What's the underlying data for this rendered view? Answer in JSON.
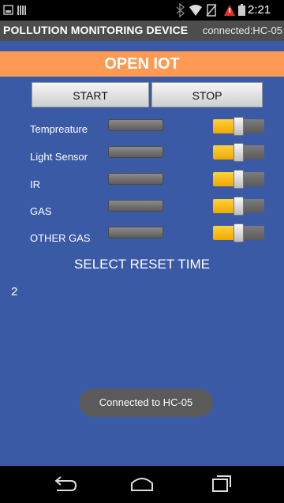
{
  "statusbar": {
    "time": "2:21"
  },
  "header": {
    "title": "POLLUTION MONITORING DEVICE",
    "connection_status": "connected:HC-05"
  },
  "banner": {
    "title": "OPEN IOT"
  },
  "controls": {
    "start_label": "START",
    "stop_label": "STOP"
  },
  "sensors": [
    {
      "label": "Tempreature",
      "toggle_on": true
    },
    {
      "label": "Light Sensor",
      "toggle_on": true
    },
    {
      "label": "IR",
      "toggle_on": true
    },
    {
      "label": "GAS",
      "toggle_on": true
    },
    {
      "label": "OTHER GAS",
      "toggle_on": true
    }
  ],
  "reset": {
    "title": "SELECT RESET TIME",
    "value": "2"
  },
  "toast": {
    "message": "Connected to HC-05"
  },
  "colors": {
    "background": "#3a5aa6",
    "banner": "#ff9a55",
    "toggle_on": "#ffc61a"
  },
  "icons": {
    "status_left": [
      "image-icon",
      "barcode-icon"
    ],
    "status_right": [
      "bluetooth-icon",
      "wifi-icon",
      "no-sim-icon",
      "warning-icon",
      "battery-icon"
    ],
    "navbar": [
      "back-icon",
      "home-icon",
      "recent-apps-icon"
    ]
  }
}
